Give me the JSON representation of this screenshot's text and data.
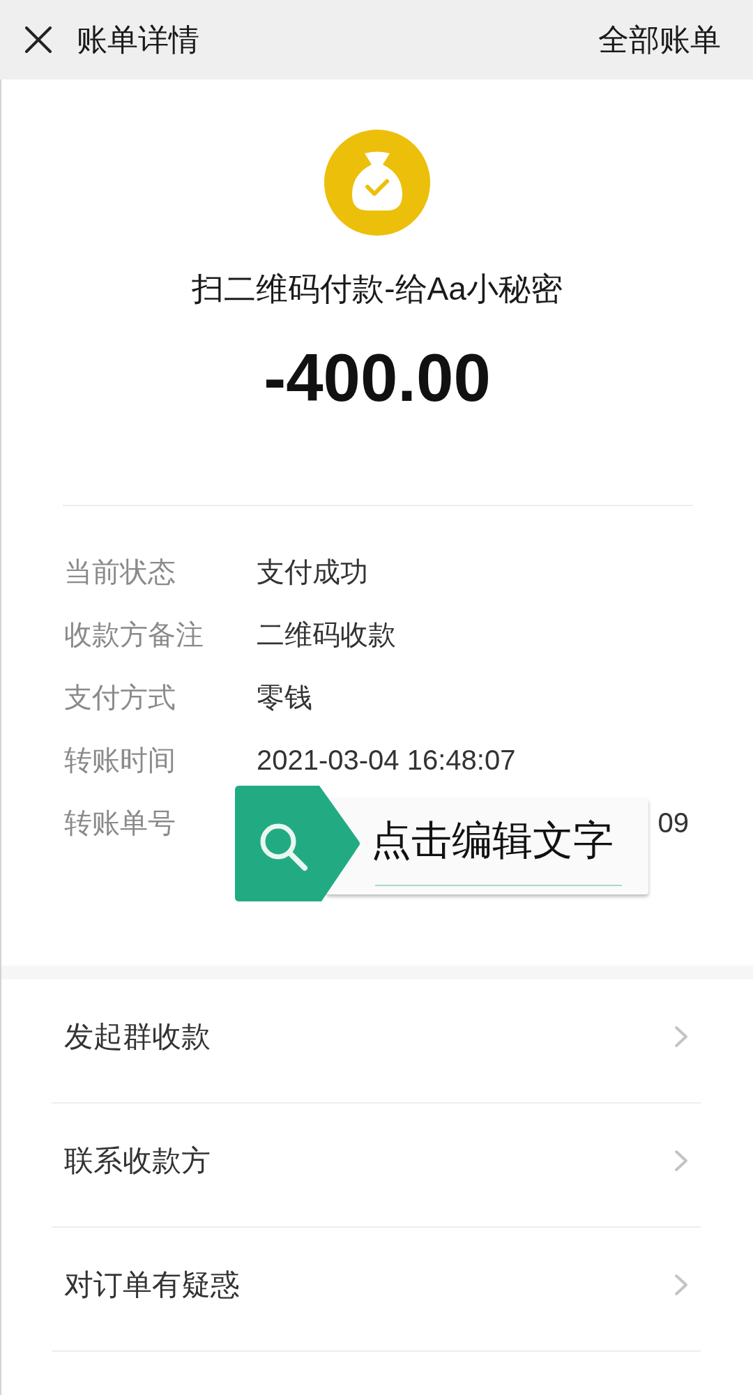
{
  "header": {
    "title": "账单详情",
    "action": "全部账单"
  },
  "summary": {
    "title": "扫二维码付款-给Aa小秘密",
    "amount": "-400.00"
  },
  "details": [
    {
      "kind": "text",
      "label": "当前状态",
      "value": "支付成功"
    },
    {
      "kind": "text",
      "label": "收款方备注",
      "value": "二维码收款"
    },
    {
      "kind": "text",
      "label": "支付方式",
      "value": "零钱"
    },
    {
      "kind": "text",
      "label": "转账时间",
      "value": "2021-03-04 16:48:07"
    },
    {
      "kind": "covered",
      "label": "转账单号",
      "value": "09"
    }
  ],
  "edit_overlay": {
    "label": "点击编辑文字"
  },
  "actions": [
    {
      "label": "发起群收款"
    },
    {
      "label": "联系收款方"
    },
    {
      "label": "对订单有疑惑"
    }
  ]
}
